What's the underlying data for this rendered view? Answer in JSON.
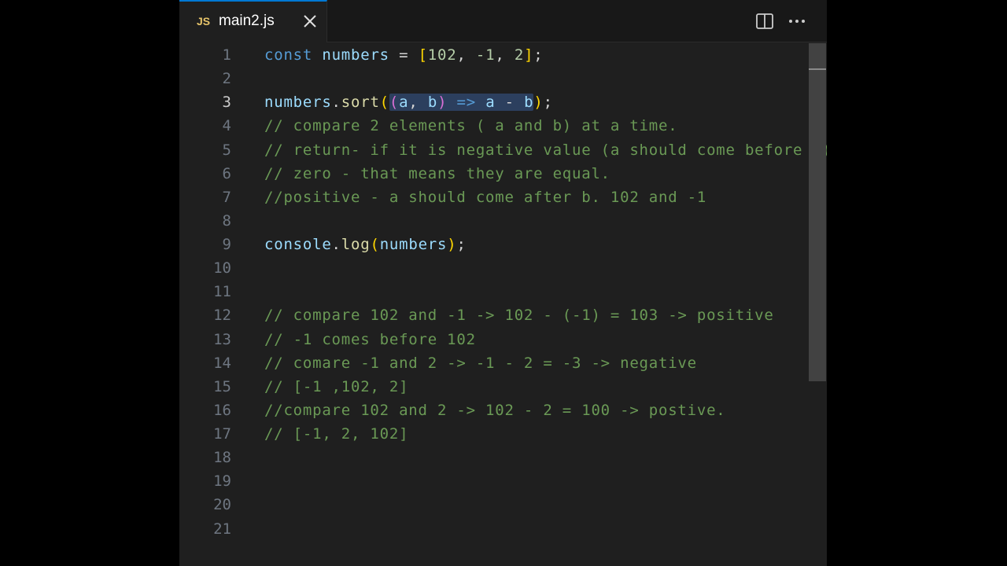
{
  "tab": {
    "lang_badge": "JS",
    "filename": "main2.js"
  },
  "icons": {
    "close": "close-icon",
    "split": "split-editor-icon",
    "more": "more-actions-icon"
  },
  "colors": {
    "keyword": "#569cd6",
    "variable": "#9cdcfe",
    "function": "#dcdcaa",
    "number": "#b5cea8",
    "comment": "#6a9955",
    "bracket_level1": "#ffd700",
    "bracket_level2": "#da70d6",
    "line_number": "#6e7681",
    "accent": "#0078d4"
  },
  "editor": {
    "active_line": 3,
    "line_numbers": [
      "1",
      "2",
      "3",
      "4",
      "5",
      "6",
      "7",
      "8",
      "9",
      "10",
      "11",
      "12",
      "13",
      "14",
      "15",
      "16",
      "17",
      "18",
      "19",
      "20",
      "21"
    ],
    "code": {
      "l1": {
        "kw": "const",
        "var": "numbers",
        "eq": " = ",
        "open": "[",
        "n1": "102",
        "c1": ", ",
        "n2": "-1",
        "c2": ", ",
        "n3": "2",
        "close": "]",
        "semi": ";"
      },
      "l3": {
        "obj": "numbers",
        "dot": ".",
        "method": "sort",
        "open": "(",
        "popen": "(",
        "a": "a",
        "comma": ", ",
        "b": "b",
        "pclose": ")",
        "arrow": " => ",
        "a2": "a",
        "minus": " - ",
        "b2": "b",
        "close": ")",
        "semi": ";"
      },
      "l4": "// compare 2 elements ( a and b) at a time.",
      "l5": "// return- if it is negative value (a should come before b)",
      "l6": "// zero - that means they are equal.",
      "l7": "//positive - a should come after b. 102 and -1",
      "l9": {
        "obj": "console",
        "dot": ".",
        "method": "log",
        "open": "(",
        "arg": "numbers",
        "close": ")",
        "semi": ";"
      },
      "l12": "// compare 102 and -1 -> 102 - (-1) = 103 -> positive",
      "l13": "// -1 comes before 102",
      "l14": "// comare -1 and 2 -> -1 - 2 = -3 -> negative",
      "l15": "// [-1 ,102, 2]",
      "l16": "//compare 102 and 2 -> 102 - 2 = 100 -> postive.",
      "l17": "// [-1, 2, 102]"
    }
  }
}
